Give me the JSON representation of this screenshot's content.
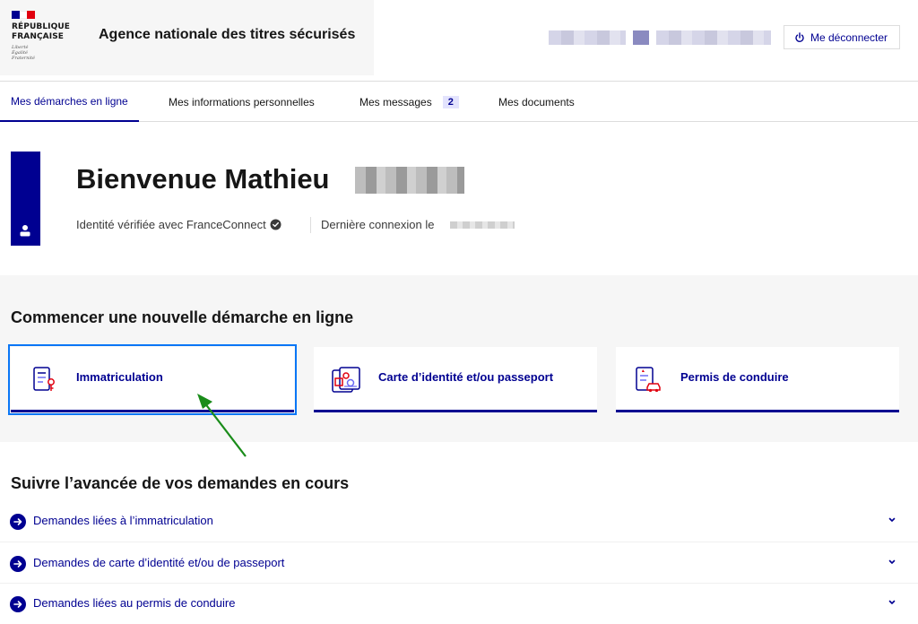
{
  "header": {
    "republic_line1": "RÉPUBLIQUE",
    "republic_line2": "FRANÇAISE",
    "motto1": "Liberté",
    "motto2": "Égalité",
    "motto3": "Fraternité",
    "agency_name": "Agence nationale des titres sécurisés",
    "logout_label": "Me déconnecter",
    "logout_icon": "power-icon"
  },
  "nav": {
    "items": [
      {
        "label": "Mes démarches en ligne",
        "active": true
      },
      {
        "label": "Mes informations personnelles",
        "active": false
      },
      {
        "label": "Mes messages",
        "active": false,
        "badge": "2"
      },
      {
        "label": "Mes documents",
        "active": false
      }
    ]
  },
  "welcome": {
    "greeting": "Bienvenue Mathieu",
    "identity_text": "Identité vérifiée avec FranceConnect",
    "last_connection": "Dernière connexion le"
  },
  "start": {
    "title": "Commencer une nouvelle démarche en ligne",
    "cards": [
      {
        "label": "Immatriculation",
        "icon": "vehicle-registration-icon"
      },
      {
        "label": "Carte d’identité et/ou passeport",
        "icon": "id-card-icon"
      },
      {
        "label": "Permis de conduire",
        "icon": "driving-licence-icon"
      }
    ]
  },
  "follow": {
    "title": "Suivre l’avancée de vos demandes en cours",
    "items": [
      {
        "label": "Demandes liées à l’immatriculation"
      },
      {
        "label": "Demandes de carte d’identité et/ou de passeport"
      },
      {
        "label": "Demandes liées au permis de conduire"
      }
    ]
  },
  "colors": {
    "primary_blue": "#000091",
    "focus_outline": "#0a76f6",
    "section_bg": "#f6f6f6",
    "annotation_arrow": "#1a8c1a"
  }
}
